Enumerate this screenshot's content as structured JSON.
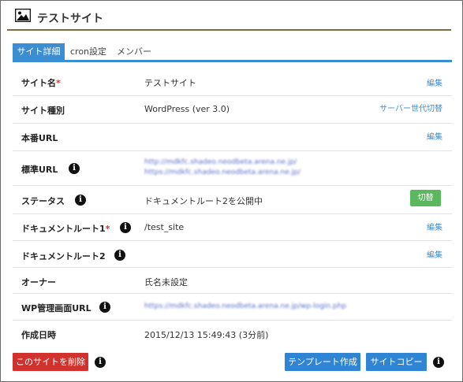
{
  "header": {
    "title": "テストサイト"
  },
  "tabs": [
    {
      "label": "サイト詳細",
      "active": true
    },
    {
      "label": "cron設定",
      "active": false
    },
    {
      "label": "メンバー",
      "active": false
    }
  ],
  "rows": {
    "site_name": {
      "label": "サイト名",
      "required_mark": "*",
      "value": "テストサイト",
      "link": "編集"
    },
    "site_type": {
      "label": "サイト種別",
      "value": "WordPress (ver 3.0)",
      "link": "サーバー世代切替"
    },
    "production_url": {
      "label": "本番URL",
      "link": "編集"
    },
    "standard_url": {
      "label": "標準URL",
      "urls": [
        "http://mdkfc.shadeo.neodbeta.arena.ne.jp/",
        "https://mdkfc.shadeo.neodbeta.arena.ne.jp/"
      ]
    },
    "status": {
      "label": "ステータス",
      "value": "ドキュメントルート2を公開中",
      "button": "切替"
    },
    "docroot1": {
      "label": "ドキュメントルート1",
      "required_mark": "*",
      "value": "/test_site",
      "link": "編集"
    },
    "docroot2": {
      "label": "ドキュメントルート2",
      "link": "編集"
    },
    "owner": {
      "label": "オーナー",
      "value": "氏名未設定"
    },
    "wp_admin_url": {
      "label": "WP管理画面URL",
      "url": "https://mdkfc.shadeo.neodbeta.arena.ne.jp/wp-login.php"
    },
    "created_at": {
      "label": "作成日時",
      "value": "2015/12/13 15:49:43 (3分前)"
    }
  },
  "footer": {
    "delete_label": "このサイトを削除",
    "template_label": "テンプレート作成",
    "copy_label": "サイトコピー"
  },
  "colors": {
    "accent": "#3a8ed1",
    "danger": "#d2322d",
    "success": "#5cb85c",
    "header_rule": "#7b6d3d"
  },
  "icons": {
    "header": "picture-icon",
    "info": "info-icon"
  }
}
